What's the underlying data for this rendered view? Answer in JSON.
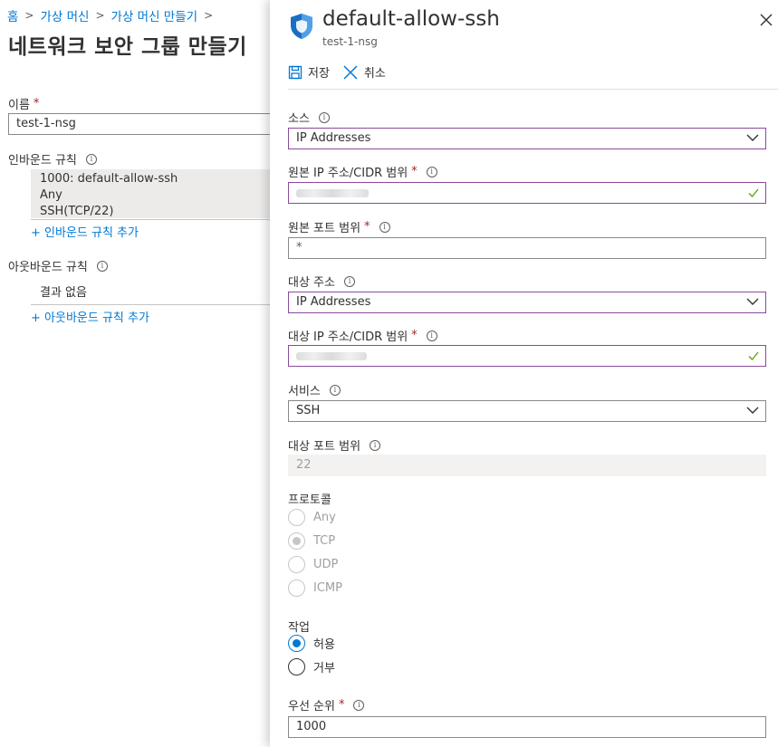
{
  "breadcrumb": {
    "items": [
      "홈",
      "가상 머신",
      "가상 머신 만들기"
    ],
    "sep": ">"
  },
  "page": {
    "title": "네트워크 보안 그룹 만들기",
    "name_label": "이름",
    "name_value": "test-1-nsg",
    "inbound_label": "인바운드 규칙",
    "inbound_rule": {
      "line1": "1000: default-allow-ssh",
      "line2": "Any",
      "line3": "SSH(TCP/22)"
    },
    "add_inbound": "+ 인바운드 규칙 추가",
    "outbound_label": "아웃바운드 규칙",
    "outbound_empty": "결과 없음",
    "add_outbound": "+ 아웃바운드 규칙 추가"
  },
  "panel": {
    "title": "default-allow-ssh",
    "subtitle": "test-1-nsg",
    "save": "저장",
    "cancel": "취소",
    "source_label": "소스",
    "source_value": "IP Addresses",
    "src_ip_label": "원본 IP 주소/CIDR 범위",
    "src_port_label": "원본 포트 범위",
    "src_port_value": "*",
    "dest_label": "대상 주소",
    "dest_value": "IP Addresses",
    "dest_ip_label": "대상 IP 주소/CIDR 범위",
    "service_label": "서비스",
    "service_value": "SSH",
    "dest_port_label": "대상 포트 범위",
    "dest_port_value": "22",
    "protocol_label": "프로토콜",
    "protocols": [
      "Any",
      "TCP",
      "UDP",
      "ICMP"
    ],
    "protocol_selected": "TCP",
    "action_label": "작업",
    "actions": [
      "허용",
      "거부"
    ],
    "action_selected": "허용",
    "priority_label": "우선 순위",
    "priority_value": "1000"
  },
  "colors": {
    "accent": "#0078d4",
    "focus_border": "#8a4a9c",
    "required": "#a4262c",
    "valid_check": "#57a300"
  },
  "icons": [
    "shield-icon",
    "close-icon",
    "save-icon",
    "cancel-icon",
    "chevron-down-icon",
    "info-icon",
    "checkmark-icon"
  ]
}
